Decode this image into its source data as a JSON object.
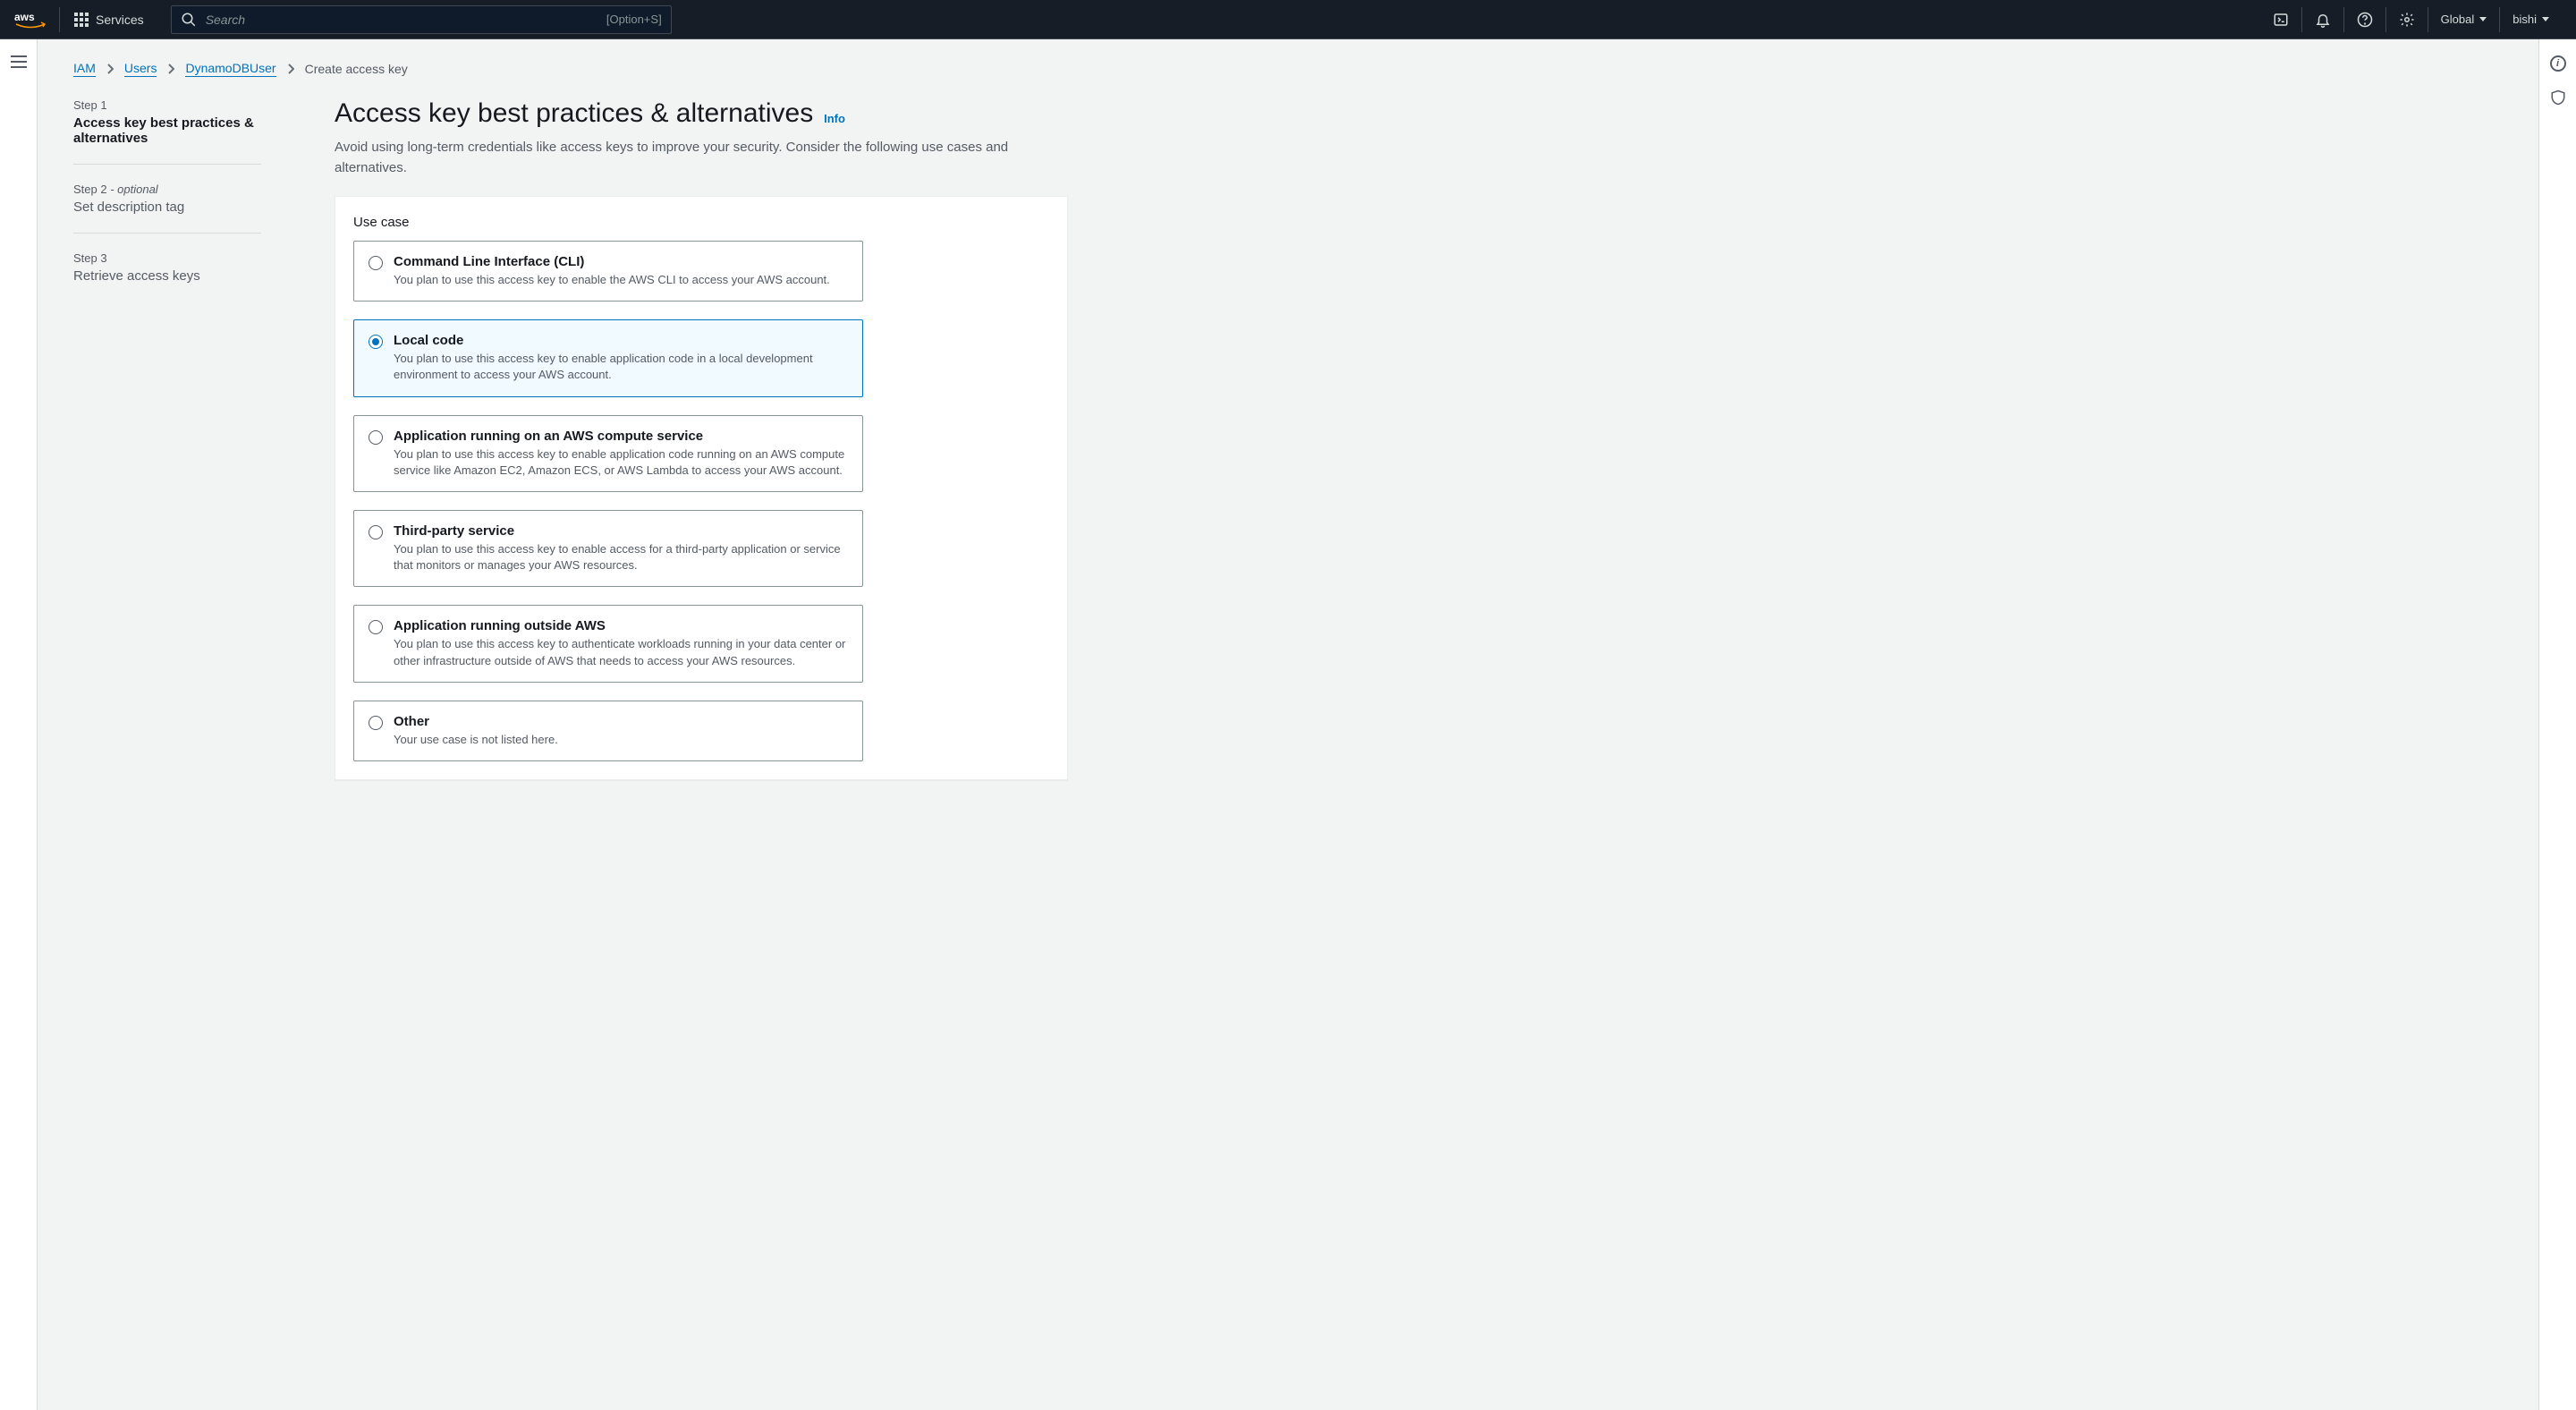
{
  "topnav": {
    "services": "Services",
    "search_placeholder": "Search",
    "search_shortcut": "[Option+S]",
    "region": "Global",
    "user": "bishi"
  },
  "breadcrumbs": {
    "items": [
      "IAM",
      "Users",
      "DynamoDBUser",
      "Create access key"
    ]
  },
  "wizard": {
    "steps": [
      {
        "num": "Step 1",
        "optional": "",
        "name": "Access key best practices & alternatives"
      },
      {
        "num": "Step 2",
        "optional": " - optional",
        "name": "Set description tag"
      },
      {
        "num": "Step 3",
        "optional": "",
        "name": "Retrieve access keys"
      }
    ]
  },
  "page": {
    "title": "Access key best practices & alternatives",
    "info_label": "Info",
    "description": "Avoid using long-term credentials like access keys to improve your security. Consider the following use cases and alternatives."
  },
  "usecase": {
    "section_title": "Use case",
    "options": [
      {
        "title": "Command Line Interface (CLI)",
        "desc": "You plan to use this access key to enable the AWS CLI to access your AWS account.",
        "selected": false
      },
      {
        "title": "Local code",
        "desc": "You plan to use this access key to enable application code in a local development environment to access your AWS account.",
        "selected": true
      },
      {
        "title": "Application running on an AWS compute service",
        "desc": "You plan to use this access key to enable application code running on an AWS compute service like Amazon EC2, Amazon ECS, or AWS Lambda to access your AWS account.",
        "selected": false
      },
      {
        "title": "Third-party service",
        "desc": "You plan to use this access key to enable access for a third-party application or service that monitors or manages your AWS resources.",
        "selected": false
      },
      {
        "title": "Application running outside AWS",
        "desc": "You plan to use this access key to authenticate workloads running in your data center or other infrastructure outside of AWS that needs to access your AWS resources.",
        "selected": false
      },
      {
        "title": "Other",
        "desc": "Your use case is not listed here.",
        "selected": false
      }
    ]
  }
}
